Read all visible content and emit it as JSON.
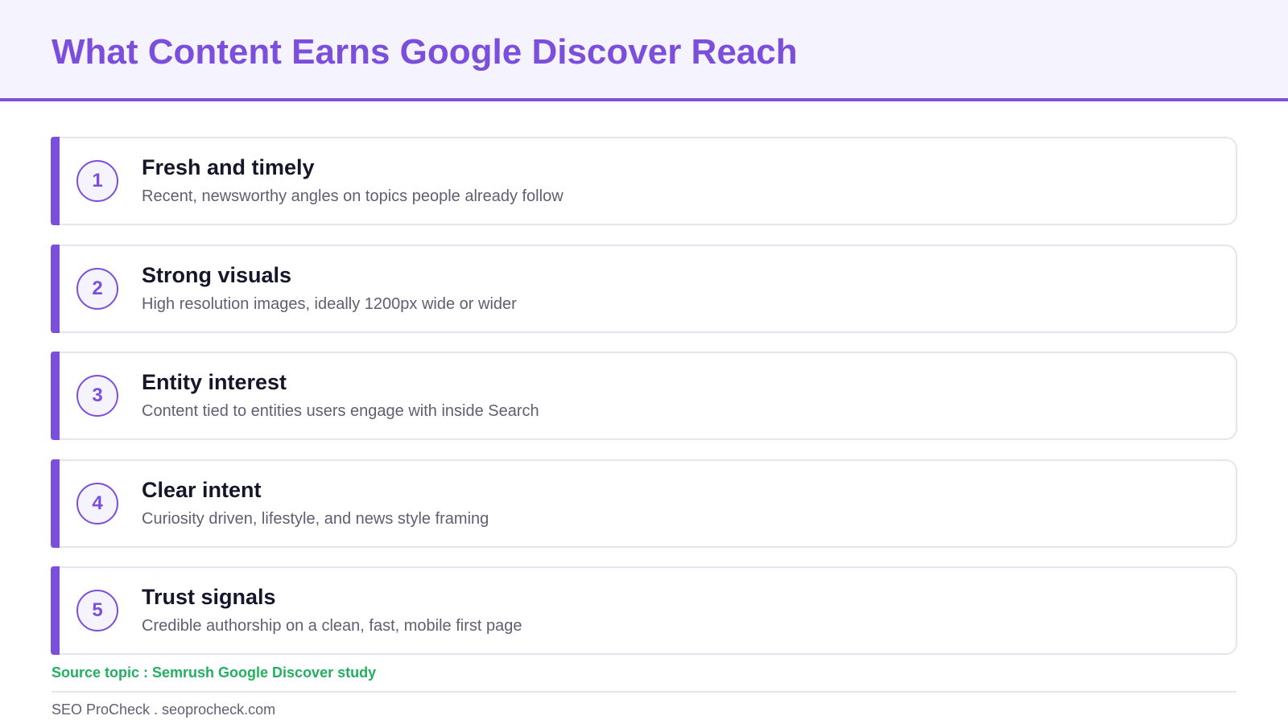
{
  "header": {
    "title": "What Content Earns Google Discover Reach"
  },
  "items": [
    {
      "number": "1",
      "title": "Fresh and timely",
      "description": "Recent, newsworthy angles on topics people already follow"
    },
    {
      "number": "2",
      "title": "Strong visuals",
      "description": "High resolution images, ideally 1200px wide or wider"
    },
    {
      "number": "3",
      "title": "Entity interest",
      "description": "Content tied to entities users engage with inside Search"
    },
    {
      "number": "4",
      "title": "Clear intent",
      "description": "Curiosity driven, lifestyle, and news style framing"
    },
    {
      "number": "5",
      "title": "Trust signals",
      "description": "Credible authorship on a clean, fast, mobile first page"
    }
  ],
  "source": "Source topic : Semrush Google Discover study",
  "footer": "SEO ProCheck . seoprocheck.com",
  "colors": {
    "accent": "#7b4fdc",
    "header_background": "#f5f3fd",
    "source_text": "#22b05f",
    "heading_text": "#16162a",
    "body_text": "#5f5f73",
    "card_border": "#e6e4ee"
  }
}
